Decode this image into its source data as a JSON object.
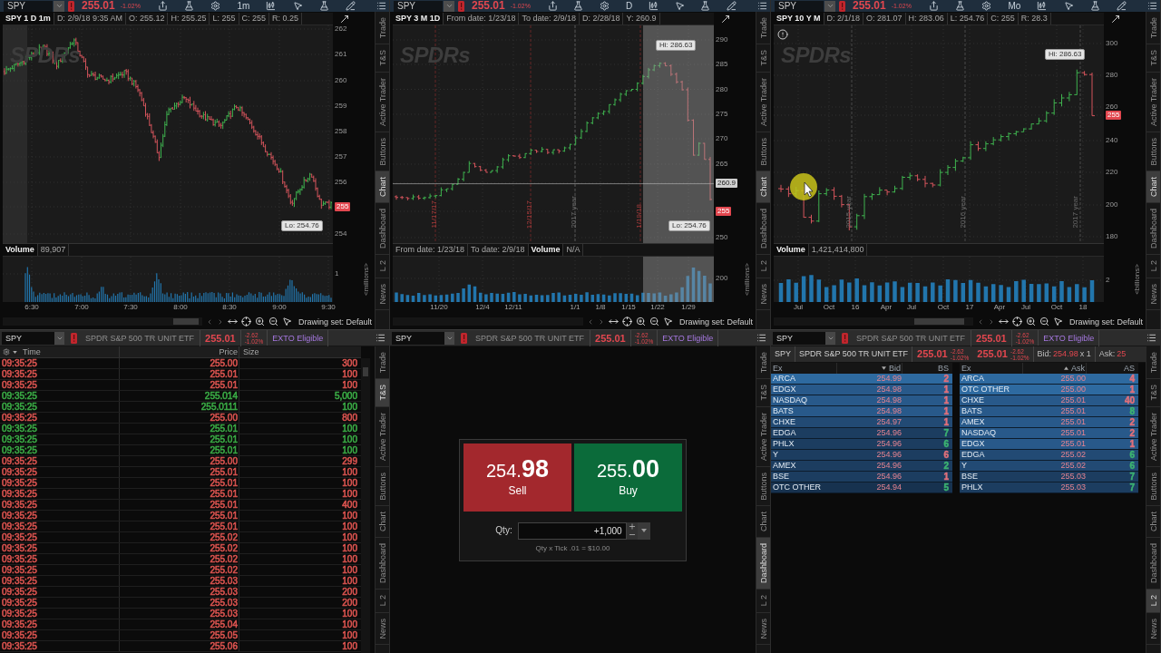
{
  "charts": [
    {
      "header": {
        "symbol": "SPY",
        "last": "255.01",
        "change_pct": "-1.02%",
        "timeframe": "1m"
      },
      "info": [
        {
          "kind": "title",
          "text": "SPY 1 D 1m"
        },
        {
          "kind": "field",
          "text": "D: 2/9/18 9:35 AM"
        },
        {
          "kind": "field",
          "text": "O: 255.12"
        },
        {
          "kind": "field",
          "text": "H: 255.25"
        },
        {
          "kind": "field",
          "text": "L: 255"
        },
        {
          "kind": "field",
          "text": "C: 255"
        },
        {
          "kind": "field",
          "text": "R: 0.25"
        }
      ],
      "logo": "SPDRs",
      "price_axis": [
        {
          "kind": "tick",
          "text": "262"
        },
        {
          "kind": "tick",
          "text": "261"
        },
        {
          "kind": "tick",
          "text": "260"
        },
        {
          "kind": "tick",
          "text": "259"
        },
        {
          "kind": "tick",
          "text": "258"
        },
        {
          "kind": "tick",
          "text": "257"
        },
        {
          "kind": "tick",
          "text": "256"
        },
        {
          "kind": "last",
          "text": "255"
        },
        {
          "kind": "tick",
          "text": "254"
        }
      ],
      "callouts": [
        "Lo: 254.76"
      ],
      "volume_info": [
        {
          "kind": "title",
          "text": "Volume"
        },
        {
          "kind": "field",
          "text": "89,907"
        }
      ],
      "volume_axis": [
        "1"
      ],
      "volume_unit": "<millions>",
      "time_axis": [
        "6:30",
        "7:00",
        "7:30",
        "8:00",
        "8:30",
        "9:00",
        "9:30"
      ],
      "drawing_set": "Drawing set: Default",
      "tabs": [
        {
          "label": "Trade",
          "selected": false
        },
        {
          "label": "T&S",
          "selected": false
        },
        {
          "label": "Active Trader",
          "selected": false
        },
        {
          "label": "Buttons",
          "selected": false
        },
        {
          "label": "Chart",
          "selected": true
        },
        {
          "label": "Dashboard",
          "selected": false
        },
        {
          "label": "L 2",
          "selected": false
        },
        {
          "label": "News",
          "selected": false
        }
      ]
    },
    {
      "header": {
        "symbol": "SPY",
        "last": "255.01",
        "change_pct": "-1.02%",
        "timeframe": "D"
      },
      "info": [
        {
          "kind": "title",
          "text": "SPY 3 M 1D"
        },
        {
          "kind": "field",
          "text": "From date: 1/23/18"
        },
        {
          "kind": "field",
          "text": "To date: 2/9/18"
        },
        {
          "kind": "field",
          "text": "D: 2/28/18"
        },
        {
          "kind": "field",
          "text": "Y: 260.9"
        }
      ],
      "logo": "SPDRs",
      "price_axis": [
        {
          "kind": "tick",
          "text": "290"
        },
        {
          "kind": "tick",
          "text": "285"
        },
        {
          "kind": "tick",
          "text": "280"
        },
        {
          "kind": "tick",
          "text": "275"
        },
        {
          "kind": "tick",
          "text": "270"
        },
        {
          "kind": "tick",
          "text": "265"
        },
        {
          "kind": "cursor",
          "text": "260.9"
        },
        {
          "kind": "last",
          "text": "255"
        },
        {
          "kind": "tick",
          "text": "250"
        }
      ],
      "callouts": [
        "Hi: 286.63",
        "Lo: 254.76"
      ],
      "markers": [
        {
          "kind": "date",
          "text": "11/17/17"
        },
        {
          "kind": "date",
          "text": "12/15/17"
        },
        {
          "kind": "year",
          "text": "2017 year"
        },
        {
          "kind": "date",
          "text": "1/19/18"
        }
      ],
      "volume_info": [
        {
          "kind": "field",
          "text": "From date: 1/23/18"
        },
        {
          "kind": "field",
          "text": "To date: 2/9/18"
        },
        {
          "kind": "title",
          "text": "Volume"
        },
        {
          "kind": "field",
          "text": "N/A"
        }
      ],
      "volume_axis": [
        "200"
      ],
      "volume_unit": "<millions>",
      "time_axis": [
        "11/20",
        "12/4",
        "12/11",
        "1/1",
        "1/8",
        "1/15",
        "1/22",
        "1/29"
      ],
      "drawing_set": "Drawing set: Default",
      "tabs": [
        {
          "label": "Trade",
          "selected": false
        },
        {
          "label": "T&S",
          "selected": false
        },
        {
          "label": "Active Trader",
          "selected": false
        },
        {
          "label": "Buttons",
          "selected": false
        },
        {
          "label": "Chart",
          "selected": true
        },
        {
          "label": "Dashboard",
          "selected": false
        },
        {
          "label": "L 2",
          "selected": false
        },
        {
          "label": "News",
          "selected": false
        }
      ]
    },
    {
      "header": {
        "symbol": "SPY",
        "last": "255.01",
        "change_pct": "-1.02%",
        "timeframe": "Mo"
      },
      "info": [
        {
          "kind": "title",
          "text": "SPY 10 Y M"
        },
        {
          "kind": "field",
          "text": "D: 2/1/18"
        },
        {
          "kind": "field",
          "text": "O: 281.07"
        },
        {
          "kind": "field",
          "text": "H: 283.06"
        },
        {
          "kind": "field",
          "text": "L: 254.76"
        },
        {
          "kind": "field",
          "text": "C: 255"
        },
        {
          "kind": "field",
          "text": "R: 28.3"
        }
      ],
      "logo": "SPDRs",
      "price_axis": [
        {
          "kind": "tick",
          "text": "300"
        },
        {
          "kind": "tick",
          "text": "280"
        },
        {
          "kind": "tick",
          "text": "260"
        },
        {
          "kind": "last",
          "text": "255"
        },
        {
          "kind": "tick",
          "text": "240"
        },
        {
          "kind": "tick",
          "text": "220"
        },
        {
          "kind": "tick",
          "text": "200"
        },
        {
          "kind": "tick",
          "text": "180"
        }
      ],
      "callouts": [
        "Hi: 286.63"
      ],
      "markers": [
        {
          "kind": "year",
          "text": "2015 year"
        },
        {
          "kind": "year",
          "text": "2016 year"
        },
        {
          "kind": "year",
          "text": "2017 year"
        }
      ],
      "volume_info": [
        {
          "kind": "title",
          "text": "Volume"
        },
        {
          "kind": "field",
          "text": "1,421,414,800"
        }
      ],
      "volume_axis": [
        "2"
      ],
      "volume_unit": "<billions>",
      "time_axis": [
        "Jul",
        "Oct",
        "16",
        "Apr",
        "Jul",
        "Oct",
        "17",
        "Apr",
        "Jul",
        "Oct",
        "18"
      ],
      "drawing_set": "Drawing set: Default",
      "tabs": [
        {
          "label": "Trade",
          "selected": false
        },
        {
          "label": "T&S",
          "selected": false
        },
        {
          "label": "Active Trader",
          "selected": false
        },
        {
          "label": "Buttons",
          "selected": false
        },
        {
          "label": "Chart",
          "selected": true
        },
        {
          "label": "Dashboard",
          "selected": false
        },
        {
          "label": "L 2",
          "selected": false
        },
        {
          "label": "News",
          "selected": false
        }
      ]
    }
  ],
  "time_and_sales": {
    "header": {
      "symbol": "SPY",
      "description": "SPDR S&P 500 TR UNIT ETF",
      "last": "255.01",
      "change": "-2.62",
      "change_pct": "-1.02%",
      "eligibility": "EXTO Eligible"
    },
    "columns": [
      "Time",
      "Price",
      "Size"
    ],
    "rows": [
      {
        "time": "09:35:25",
        "price": "255.00",
        "size": "300",
        "color": "#d9534f"
      },
      {
        "time": "09:35:25",
        "price": "255.01",
        "size": "100",
        "color": "#d9534f"
      },
      {
        "time": "09:35:25",
        "price": "255.01",
        "size": "100",
        "color": "#d9534f"
      },
      {
        "time": "09:35:25",
        "price": "255.014",
        "size": "5,000",
        "color": "#3aaa45"
      },
      {
        "time": "09:35:25",
        "price": "255.0111",
        "size": "100",
        "color": "#3aaa45"
      },
      {
        "time": "09:35:25",
        "price": "255.00",
        "size": "800",
        "color": "#d9534f"
      },
      {
        "time": "09:35:25",
        "price": "255.01",
        "size": "100",
        "color": "#3aaa45"
      },
      {
        "time": "09:35:25",
        "price": "255.01",
        "size": "100",
        "color": "#3aaa45"
      },
      {
        "time": "09:35:25",
        "price": "255.01",
        "size": "100",
        "color": "#3aaa45"
      },
      {
        "time": "09:35:25",
        "price": "255.00",
        "size": "299",
        "color": "#d9534f"
      },
      {
        "time": "09:35:25",
        "price": "255.01",
        "size": "100",
        "color": "#d9534f"
      },
      {
        "time": "09:35:25",
        "price": "255.01",
        "size": "100",
        "color": "#d9534f"
      },
      {
        "time": "09:35:25",
        "price": "255.01",
        "size": "100",
        "color": "#d9534f"
      },
      {
        "time": "09:35:25",
        "price": "255.01",
        "size": "400",
        "color": "#d9534f"
      },
      {
        "time": "09:35:25",
        "price": "255.01",
        "size": "100",
        "color": "#d9534f"
      },
      {
        "time": "09:35:25",
        "price": "255.01",
        "size": "100",
        "color": "#d9534f"
      },
      {
        "time": "09:35:25",
        "price": "255.02",
        "size": "100",
        "color": "#d9534f"
      },
      {
        "time": "09:35:25",
        "price": "255.02",
        "size": "100",
        "color": "#d9534f"
      },
      {
        "time": "09:35:25",
        "price": "255.02",
        "size": "100",
        "color": "#d9534f"
      },
      {
        "time": "09:35:25",
        "price": "255.02",
        "size": "100",
        "color": "#d9534f"
      },
      {
        "time": "09:35:25",
        "price": "255.03",
        "size": "100",
        "color": "#d9534f"
      },
      {
        "time": "09:35:25",
        "price": "255.03",
        "size": "200",
        "color": "#d9534f"
      },
      {
        "time": "09:35:25",
        "price": "255.03",
        "size": "200",
        "color": "#d9534f"
      },
      {
        "time": "09:35:25",
        "price": "255.03",
        "size": "100",
        "color": "#d9534f"
      },
      {
        "time": "09:35:25",
        "price": "255.04",
        "size": "100",
        "color": "#d9534f"
      },
      {
        "time": "09:35:25",
        "price": "255.05",
        "size": "100",
        "color": "#d9534f"
      },
      {
        "time": "09:35:25",
        "price": "255.06",
        "size": "100",
        "color": "#d9534f"
      }
    ],
    "tabs": [
      {
        "label": "Trade",
        "selected": false
      },
      {
        "label": "T&S",
        "selected": true
      },
      {
        "label": "Active Trader",
        "selected": false
      },
      {
        "label": "Buttons",
        "selected": false
      },
      {
        "label": "Chart",
        "selected": false
      },
      {
        "label": "Dashboard",
        "selected": false
      },
      {
        "label": "L 2",
        "selected": false
      },
      {
        "label": "News",
        "selected": false
      }
    ]
  },
  "order_entry": {
    "header": {
      "symbol": "SPY",
      "description": "SPDR S&P 500 TR UNIT ETF",
      "last": "255.01",
      "change": "-2.62",
      "change_pct": "-1.02%",
      "eligibility": "EXTO Eligible"
    },
    "sell": {
      "price": "254.**98**",
      "label": "Sell"
    },
    "buy": {
      "price": "255.**00**",
      "label": "Buy"
    },
    "qty": {
      "label": "Qty:",
      "value": "+1,000"
    },
    "hint": "Qty x Tick .01 = $10.00",
    "tabs": [
      {
        "label": "Trade",
        "selected": false
      },
      {
        "label": "T&S",
        "selected": false
      },
      {
        "label": "Active Trader",
        "selected": false
      },
      {
        "label": "Buttons",
        "selected": false
      },
      {
        "label": "Chart",
        "selected": false
      },
      {
        "label": "Dashboard",
        "selected": true
      },
      {
        "label": "L 2",
        "selected": false
      },
      {
        "label": "News",
        "selected": false
      }
    ]
  },
  "level2": {
    "header": {
      "symbol": "SPY",
      "description": "SPDR S&P 500 TR UNIT ETF",
      "last": "255.01",
      "change": "-2.62",
      "change_pct": "-1.02%",
      "eligibility": "EXTO Eligible"
    },
    "quote": {
      "symbol": "SPY",
      "description": "SPDR S&P 500 TR UNIT ETF",
      "quotes": [
        {
          "last": "255.01",
          "change": "-2.62",
          "change_pct": "-1.02%"
        },
        {
          "last": "255.01",
          "change": "-2.62",
          "change_pct": "-1.02%"
        }
      ],
      "bid": {
        "label": "Bid:",
        "price": "254.98",
        "size": "x 1"
      },
      "ask": {
        "label": "Ask:",
        "price": "25"
      }
    },
    "bid_columns": [
      "Ex",
      "Bid",
      "BS"
    ],
    "ask_columns": [
      "Ex",
      "Ask",
      "AS"
    ],
    "bids": [
      {
        "ex": "ARCA",
        "price": "254.99",
        "size": {
          "text": "2",
          "color": "#e0707a"
        },
        "color": "#2e6aa0"
      },
      {
        "ex": "EDGX",
        "price": "254.98",
        "size": {
          "text": "1",
          "color": "#e0707a"
        },
        "color": "#28598a"
      },
      {
        "ex": "NASDAQ",
        "price": "254.98",
        "size": {
          "text": "1",
          "color": "#e0707a"
        },
        "color": "#28598a"
      },
      {
        "ex": "BATS",
        "price": "254.98",
        "size": {
          "text": "1",
          "color": "#e0707a"
        },
        "color": "#28598a"
      },
      {
        "ex": "CHXE",
        "price": "254.97",
        "size": {
          "text": "1",
          "color": "#e0707a"
        },
        "color": "#224a74"
      },
      {
        "ex": "EDGA",
        "price": "254.96",
        "size": {
          "text": "7",
          "color": "#3cb371"
        },
        "color": "#1c3d60"
      },
      {
        "ex": "PHLX",
        "price": "254.96",
        "size": {
          "text": "6",
          "color": "#3cb371"
        },
        "color": "#1c3d60"
      },
      {
        "ex": "Y",
        "price": "254.96",
        "size": {
          "text": "6",
          "color": "#e0707a"
        },
        "color": "#1c3d60"
      },
      {
        "ex": "AMEX",
        "price": "254.96",
        "size": {
          "text": "2",
          "color": "#3cb371"
        },
        "color": "#1c3d60"
      },
      {
        "ex": "BSE",
        "price": "254.96",
        "size": {
          "text": "1",
          "color": "#e0707a"
        },
        "color": "#1c3d60"
      },
      {
        "ex": "OTC OTHER",
        "price": "254.94",
        "size": {
          "text": "5",
          "color": "#3cb371"
        },
        "color": "#17324f"
      }
    ],
    "asks": [
      {
        "ex": "ARCA",
        "price": "255.00",
        "size": {
          "text": "4",
          "color": "#e0707a"
        },
        "color": "#2e6aa0"
      },
      {
        "ex": "OTC OTHER",
        "price": "255.00",
        "size": {
          "text": "1",
          "color": "#e0707a"
        },
        "color": "#2e6aa0"
      },
      {
        "ex": "CHXE",
        "price": "255.01",
        "size": {
          "text": "40",
          "color": "#e0707a"
        },
        "color": "#28598a"
      },
      {
        "ex": "BATS",
        "price": "255.01",
        "size": {
          "text": "8",
          "color": "#3cb371"
        },
        "color": "#28598a"
      },
      {
        "ex": "AMEX",
        "price": "255.01",
        "size": {
          "text": "2",
          "color": "#e0707a"
        },
        "color": "#28598a"
      },
      {
        "ex": "NASDAQ",
        "price": "255.01",
        "size": {
          "text": "2",
          "color": "#e0707a"
        },
        "color": "#28598a"
      },
      {
        "ex": "EDGX",
        "price": "255.01",
        "size": {
          "text": "1",
          "color": "#e0707a"
        },
        "color": "#28598a"
      },
      {
        "ex": "EDGA",
        "price": "255.02",
        "size": {
          "text": "6",
          "color": "#3cb371"
        },
        "color": "#224a74"
      },
      {
        "ex": "Y",
        "price": "255.02",
        "size": {
          "text": "6",
          "color": "#3cb371"
        },
        "color": "#224a74"
      },
      {
        "ex": "BSE",
        "price": "255.03",
        "size": {
          "text": "7",
          "color": "#3cb371"
        },
        "color": "#1c3d60"
      },
      {
        "ex": "PHLX",
        "price": "255.03",
        "size": {
          "text": "7",
          "color": "#3cb371"
        },
        "color": "#1c3d60"
      }
    ],
    "tabs": [
      {
        "label": "Trade",
        "selected": false
      },
      {
        "label": "T&S",
        "selected": false
      },
      {
        "label": "Active Trader",
        "selected": false
      },
      {
        "label": "Buttons",
        "selected": false
      },
      {
        "label": "Chart",
        "selected": false
      },
      {
        "label": "Dashboard",
        "selected": false
      },
      {
        "label": "L 2",
        "selected": true
      },
      {
        "label": "News",
        "selected": false
      }
    ]
  }
}
